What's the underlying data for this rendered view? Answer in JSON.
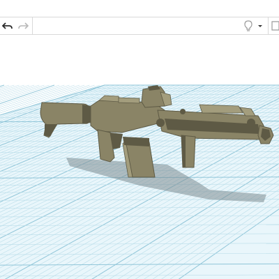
{
  "app": {
    "view": "3D workplane"
  },
  "toolbar": {
    "undo_icon": "undo-arrow-icon",
    "redo_icon": "redo-arrow-icon",
    "bulb_icon": "lightbulb-icon",
    "dropdown_icon": "caret-down-icon",
    "notes_icon": "note-icon"
  },
  "colors": {
    "grid_fill": "#e9f6fb",
    "grid_line": "#b9dde9",
    "grid_major": "#8fc5d8",
    "model": "#8a8466",
    "model_dark": "#5e5a45",
    "model_light": "#a39d7d",
    "shadow": "#7e8c92"
  },
  "model": {
    "name": "rifle-model"
  }
}
